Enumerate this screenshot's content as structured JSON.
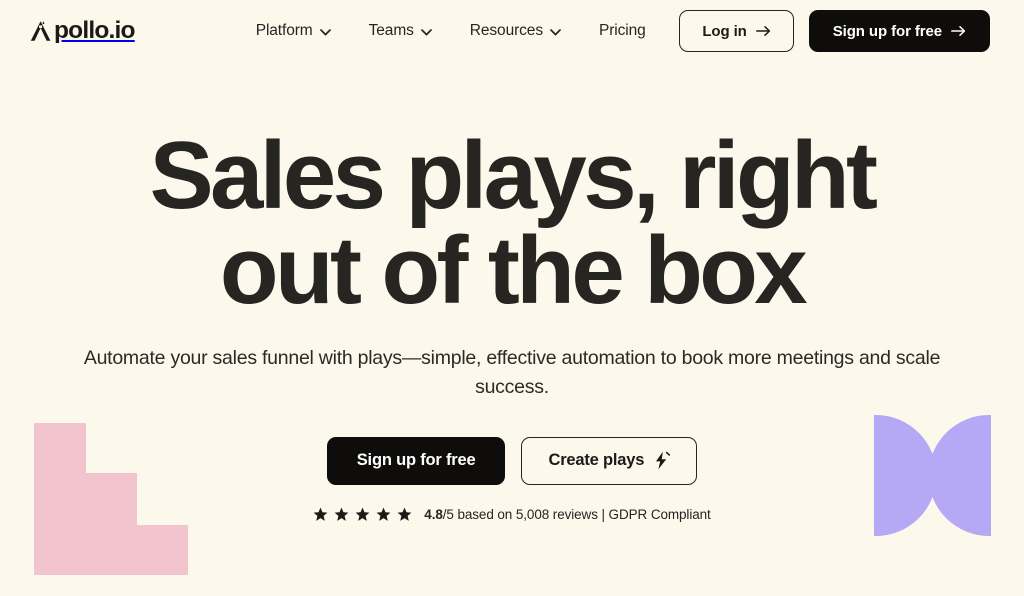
{
  "theme": {
    "background": "#FDF8EC",
    "text": "#262522",
    "dark_button": "#0E0D0B",
    "pink_decor": "#F2C4CE",
    "purple_decor": "#B5A8F5"
  },
  "header": {
    "logo": {
      "mark_name": "apollo-chevron-logomark",
      "wordmark": "pollo.io"
    },
    "nav": [
      {
        "label": "Platform",
        "has_dropdown": true,
        "icon": "chevron-down-icon"
      },
      {
        "label": "Teams",
        "has_dropdown": true,
        "icon": "chevron-down-icon"
      },
      {
        "label": "Resources",
        "has_dropdown": true,
        "icon": "chevron-down-icon"
      },
      {
        "label": "Pricing",
        "has_dropdown": false,
        "icon": ""
      }
    ],
    "login_label": "Log in",
    "login_icon": "arrow-right-icon",
    "signup_label": "Sign up for free",
    "signup_icon": "arrow-right-icon"
  },
  "hero": {
    "headline_line1": "Sales plays, right",
    "headline_line2": "out of the box",
    "subheadline": "Automate your sales funnel with plays—simple, effective automation to book more meetings and scale success.",
    "primary_cta": "Sign up for free",
    "secondary_cta": "Create plays",
    "secondary_cta_icon": "lightning-bolt-icon",
    "rating": {
      "star_count": 5,
      "star_icon": "star-filled-icon",
      "score": "4.8",
      "suffix": "/5 based on 5,008 reviews | GDPR Compliant"
    }
  },
  "decor": {
    "left_shape_name": "pink-staircase-shape",
    "right_shape_name": "purple-double-semicircle-shape"
  }
}
